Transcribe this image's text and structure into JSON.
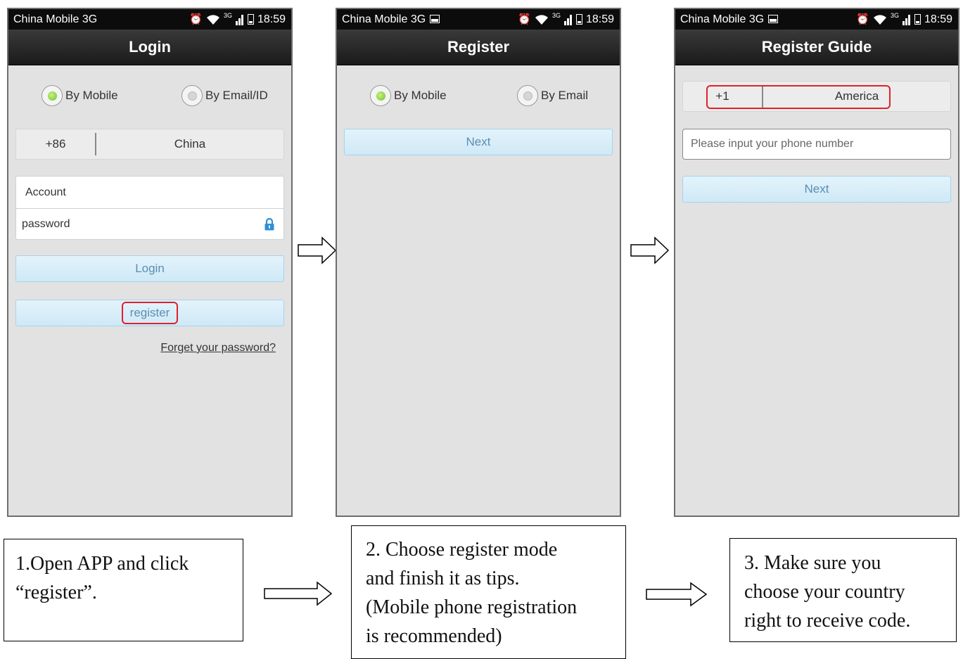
{
  "status": {
    "carrier": "China Mobile 3G",
    "network": "3G",
    "time": "18:59"
  },
  "screen1": {
    "title": "Login",
    "radio_mobile": "By Mobile",
    "radio_email": "By Email/ID",
    "country_code": "+86",
    "country_name": "China",
    "account_placeholder": "Account",
    "password_placeholder": "password",
    "login_label": "Login",
    "register_label": "register",
    "forget_label": "Forget your password?"
  },
  "screen2": {
    "title": "Register",
    "radio_mobile": "By Mobile",
    "radio_email": "By Email",
    "next_label": "Next"
  },
  "screen3": {
    "title": "Register Guide",
    "country_code": "+1",
    "country_name": "America",
    "phone_placeholder": "Please input your phone number",
    "next_label": "Next"
  },
  "captions": {
    "step1": [
      "1.Open APP and click",
      "“register”."
    ],
    "step2": [
      "2. Choose register mode",
      "and finish it as tips.",
      "(Mobile phone registration",
      "is recommended)"
    ],
    "step3": [
      "3. Make sure you",
      "choose your country",
      "right to receive code."
    ]
  },
  "colors": {
    "highlight": "#e2202b",
    "button_text": "#5a8eb3",
    "titlebar": "#1a1a1a"
  },
  "icons": [
    "alarm-icon",
    "wifi-icon",
    "signal-icon",
    "battery-icon",
    "lock-icon",
    "arrow-right-icon",
    "image-thumbnail-icon"
  ]
}
